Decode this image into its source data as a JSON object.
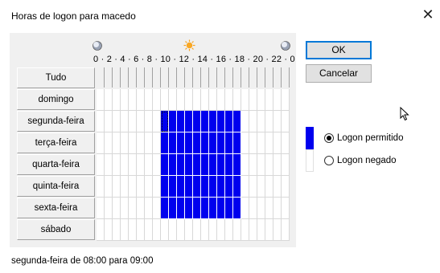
{
  "window": {
    "title": "Horas de logon para macedo",
    "close_glyph": "✕"
  },
  "hour_scale": {
    "labels": "0 · 2 · 4 · 6 · 8 · 10 · 12 · 14 · 16 · 18 · 20 · 22 · 0",
    "icons": [
      "moon-icon",
      "sun-icon",
      "moon-icon"
    ]
  },
  "grid": {
    "all_label": "Tudo",
    "days": [
      {
        "label": "domingo",
        "allowed_hours": []
      },
      {
        "label": "segunda-feira",
        "allowed_hours": [
          8,
          9,
          10,
          11,
          12,
          13,
          14,
          15,
          16,
          17
        ]
      },
      {
        "label": "terça-feira",
        "allowed_hours": [
          8,
          9,
          10,
          11,
          12,
          13,
          14,
          15,
          16,
          17
        ]
      },
      {
        "label": "quarta-feira",
        "allowed_hours": [
          8,
          9,
          10,
          11,
          12,
          13,
          14,
          15,
          16,
          17
        ]
      },
      {
        "label": "quinta-feira",
        "allowed_hours": [
          8,
          9,
          10,
          11,
          12,
          13,
          14,
          15,
          16,
          17
        ]
      },
      {
        "label": "sexta-feira",
        "allowed_hours": [
          8,
          9,
          10,
          11,
          12,
          13,
          14,
          15,
          16,
          17
        ]
      },
      {
        "label": "sábado",
        "allowed_hours": []
      }
    ],
    "focus": {
      "day": 1,
      "hour": 8
    },
    "allowed_color": "#0000ee",
    "denied_color": "#ffffff"
  },
  "buttons": {
    "ok": "OK",
    "cancel": "Cancelar"
  },
  "legend": {
    "allowed_label": "Logon permitido",
    "denied_label": "Logon negado",
    "selected": "allowed"
  },
  "status": "segunda-feira de 08:00 para 09:00"
}
